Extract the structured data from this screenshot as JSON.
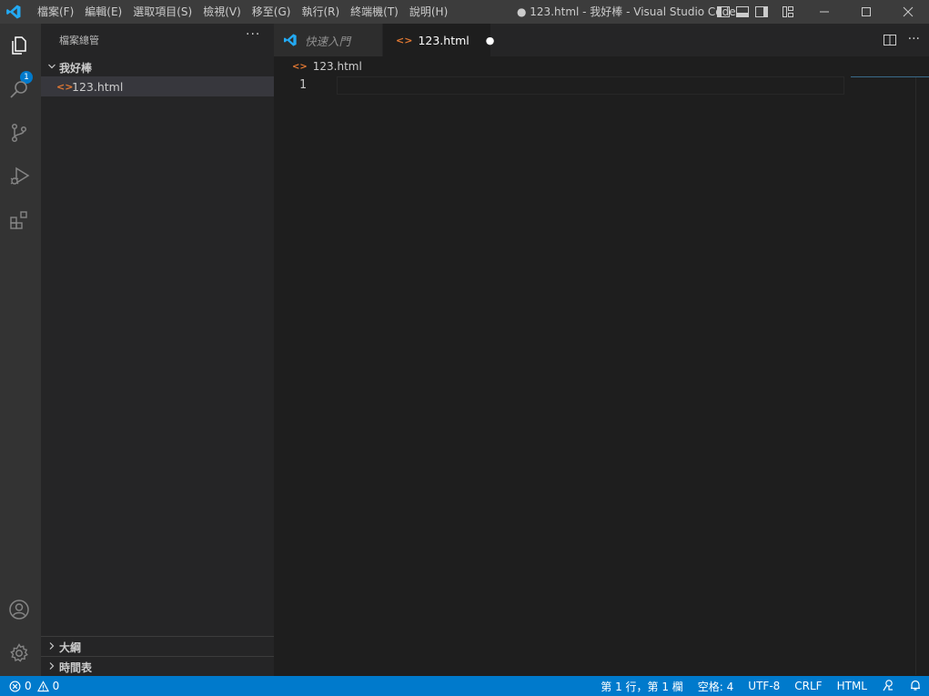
{
  "titlebar": {
    "menu": [
      "檔案(F)",
      "編輯(E)",
      "選取項目(S)",
      "檢視(V)",
      "移至(G)",
      "執行(R)",
      "終端機(T)",
      "說明(H)"
    ],
    "title": "● 123.html - 我好棒 - Visual Studio Code"
  },
  "activity": {
    "explorer_badge": "1"
  },
  "sidebar": {
    "title": "檔案總管",
    "more": "···",
    "folder": "我好棒",
    "file": "123.html",
    "file_icon": "<>",
    "sections": [
      "大綱",
      "時間表"
    ]
  },
  "editor": {
    "tabs": [
      {
        "label": "快速入門"
      },
      {
        "label": "123.html",
        "dirty_marker": "●"
      }
    ],
    "breadcrumb": "123.html",
    "line_number": "1"
  },
  "statusbar": {
    "errors": "0",
    "warnings": "0",
    "position": "第 1 行，第 1 欄",
    "indent": "空格: 4",
    "encoding": "UTF-8",
    "eol": "CRLF",
    "language": "HTML"
  },
  "colors": {
    "accent": "#007acc",
    "file_icon": "#e37933",
    "vscode_logo": "#23a9f2"
  }
}
